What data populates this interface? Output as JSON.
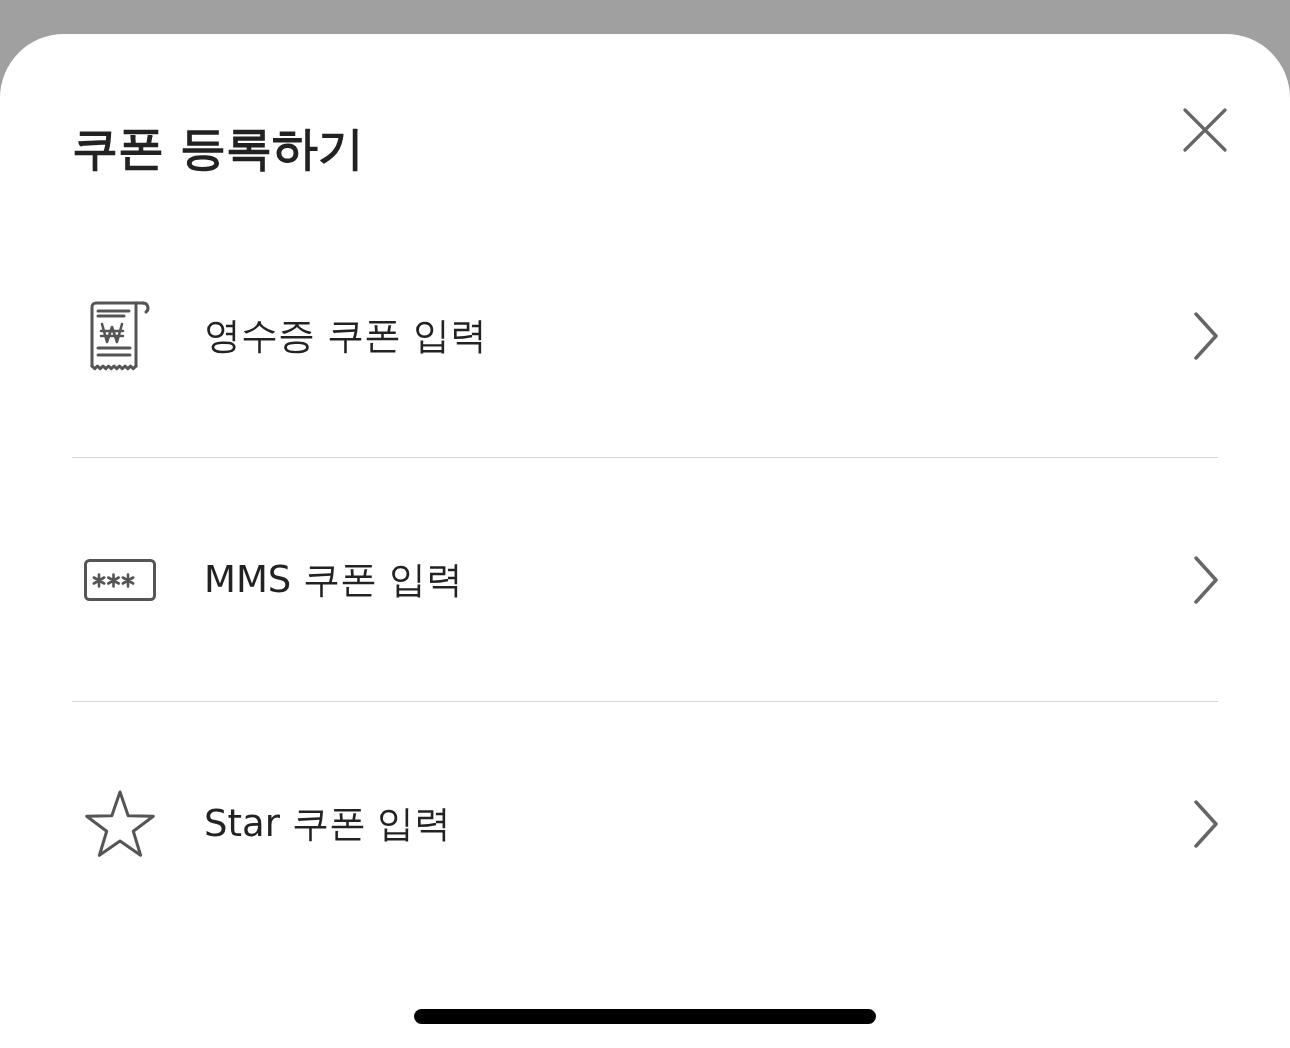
{
  "sheet": {
    "title": "쿠폰 등록하기"
  },
  "options": [
    {
      "kind": "receipt",
      "label": "영수증 쿠폰 입력"
    },
    {
      "kind": "mms",
      "label": "MMS 쿠폰 입력"
    },
    {
      "kind": "star",
      "label": "Star 쿠폰 입력"
    }
  ]
}
